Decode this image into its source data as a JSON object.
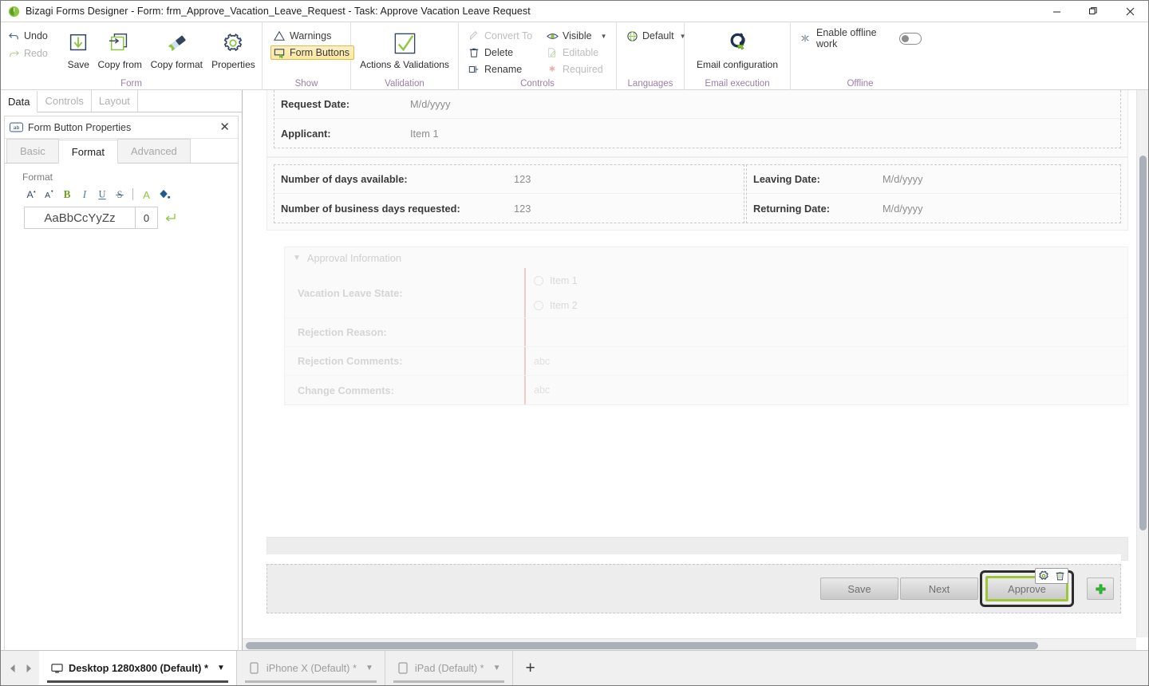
{
  "window": {
    "title": "Bizagi Forms Designer  - Form: frm_Approve_Vacation_Leave_Request - Task:  Approve Vacation Leave Request",
    "minimize_label": "─",
    "maximize_label": "❐",
    "close_label": "✕"
  },
  "ribbon": {
    "groups": {
      "form": {
        "label": "Form",
        "undo": "Undo",
        "redo": "Redo",
        "save": "Save",
        "copy_from": "Copy from",
        "copy_format": "Copy format",
        "properties": "Properties"
      },
      "show": {
        "label": "Show",
        "warnings": "Warnings",
        "form_buttons": "Form Buttons"
      },
      "validation": {
        "label": "Validation",
        "actions_validations": "Actions & Validations"
      },
      "controls": {
        "label": "Controls",
        "convert_to": "Convert To",
        "delete": "Delete",
        "rename": "Rename",
        "visible": "Visible",
        "editable": "Editable",
        "required": "Required"
      },
      "languages": {
        "label": "Languages",
        "default": "Default"
      },
      "email": {
        "label": "Email execution",
        "email_configuration": "Email configuration"
      },
      "offline": {
        "label": "Offline",
        "enable_offline_work": "Enable offline work",
        "toggle_state": "off"
      }
    }
  },
  "left_panel": {
    "tabs": [
      {
        "label": "Data",
        "selected": true
      },
      {
        "label": "Controls",
        "selected": false
      },
      {
        "label": "Layout",
        "selected": false
      }
    ],
    "properties": {
      "title": "Form Button Properties",
      "close_label": "✕",
      "tabs": [
        {
          "label": "Basic",
          "selected": false
        },
        {
          "label": "Format",
          "selected": true
        },
        {
          "label": "Advanced",
          "selected": false
        }
      ],
      "format_section_title": "Format",
      "format_tools": [
        "increase-font-size",
        "decrease-font-size",
        "bold",
        "italic",
        "underline",
        "strikethrough",
        "font-color",
        "highlight-color"
      ],
      "preview_text": "AaBbCcYyZz",
      "size_value": "0",
      "reset_icon": "reset-format-icon"
    }
  },
  "form": {
    "top_section": {
      "rows": [
        {
          "label": "Request Date:",
          "value": "M/d/yyyy"
        },
        {
          "label": "Applicant:",
          "value": "Item 1"
        }
      ]
    },
    "days_section": {
      "left_rows": [
        {
          "label": "Number of days available:",
          "value": "123"
        },
        {
          "label": "Number of business days requested:",
          "value": "123"
        }
      ],
      "right_rows": [
        {
          "label": "Leaving Date:",
          "value": "M/d/yyyy"
        },
        {
          "label": "Returning Date:",
          "value": "M/d/yyyy"
        }
      ]
    },
    "approval_section": {
      "title": "Approval Information",
      "collapse_icon": "chevron-down-icon",
      "rows": [
        {
          "label": "Vacation Leave State:",
          "type": "radio-group",
          "options": [
            "Item 1",
            "Item 2"
          ]
        },
        {
          "label": "Rejection Reason:",
          "type": "dropdown",
          "value": ""
        },
        {
          "label": "Rejection Comments:",
          "type": "text",
          "placeholder": "abc"
        },
        {
          "label": "Change Comments:",
          "type": "text",
          "placeholder": "abc"
        }
      ]
    },
    "buttons": {
      "save": "Save",
      "next": "Next",
      "approve": "Approve",
      "add": "+",
      "selected": "Approve",
      "selection_tools": [
        "gear-icon",
        "trash-icon"
      ]
    }
  },
  "device_bar": {
    "prev_label": "◀",
    "next_label": "▶",
    "tabs": [
      {
        "label": "Desktop 1280x800 (Default) *",
        "icon": "monitor-icon",
        "selected": true
      },
      {
        "label": "iPhone X (Default) *",
        "icon": "phone-icon",
        "selected": false
      },
      {
        "label": "iPad (Default) *",
        "icon": "tablet-icon",
        "selected": false
      }
    ],
    "add_label": "+"
  },
  "colors": {
    "accent_green": "#8cc63f",
    "ribbon_group_label": "#9a7fa8",
    "highlight_yellow": "#fbe79e",
    "selection_border": "#2d2d2d",
    "required_pink": "#f6c9c9"
  }
}
